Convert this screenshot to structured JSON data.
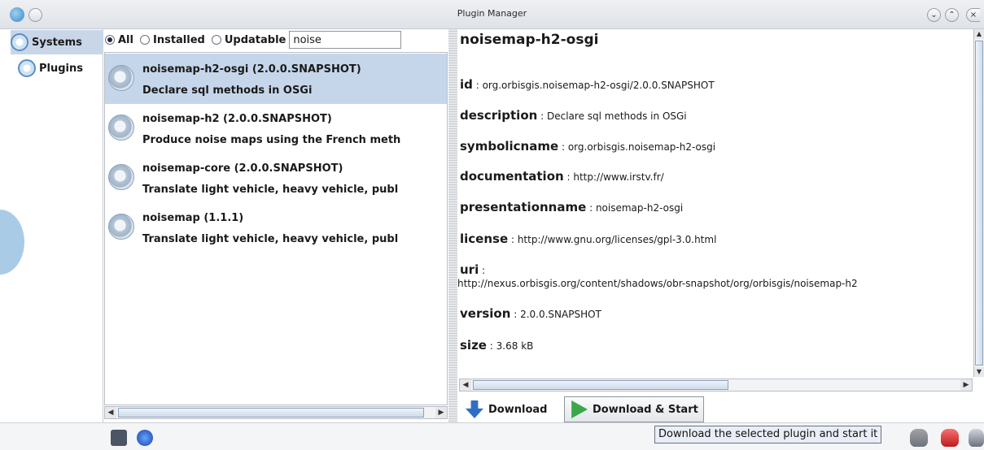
{
  "window": {
    "title": "Plugin Manager",
    "controls": [
      "minimize",
      "maximize",
      "close"
    ]
  },
  "nav": {
    "items": [
      {
        "label": "Systems",
        "selected": true
      },
      {
        "label": "Plugins",
        "selected": false
      }
    ]
  },
  "filter": {
    "options": [
      {
        "label": "All",
        "checked": true
      },
      {
        "label": "Installed",
        "checked": false
      },
      {
        "label": "Updatable",
        "checked": false
      }
    ],
    "search_value": "noise"
  },
  "plugins": [
    {
      "title": "noisemap-h2-osgi (2.0.0.SNAPSHOT)",
      "description": "Declare sql methods in OSGi",
      "selected": true
    },
    {
      "title": "noisemap-h2 (2.0.0.SNAPSHOT)",
      "description": "Produce noise maps using the French meth",
      "selected": false
    },
    {
      "title": "noisemap-core (2.0.0.SNAPSHOT)",
      "description": "Translate light vehicle, heavy vehicle, publ",
      "selected": false
    },
    {
      "title": "noisemap (1.1.1)",
      "description": "Translate light vehicle, heavy vehicle, publ",
      "selected": false
    }
  ],
  "details": {
    "title": "noisemap-h2-osgi",
    "properties": [
      {
        "key": "id",
        "sep": " : ",
        "value": "org.orbisgis.noisemap-h2-osgi/2.0.0.SNAPSHOT"
      },
      {
        "key": "description",
        "sep": " : ",
        "value": "Declare sql methods in OSGi"
      },
      {
        "key": "symbolicname",
        "sep": " : ",
        "value": "org.orbisgis.noisemap-h2-osgi"
      },
      {
        "key": "documentation",
        "sep": " : ",
        "value": "http://www.irstv.fr/"
      },
      {
        "key": "presentationname",
        "sep": " : ",
        "value": "noisemap-h2-osgi"
      },
      {
        "key": "license",
        "sep": " : ",
        "value": "http://www.gnu.org/licenses/gpl-3.0.html"
      },
      {
        "key": "uri",
        "sep": " :",
        "value": ""
      },
      {
        "key": "version",
        "sep": " : ",
        "value": "2.0.0.SNAPSHOT"
      },
      {
        "key": "size",
        "sep": " : ",
        "value": "3.68 kB"
      }
    ],
    "uri_value": "http://nexus.orbisgis.org/content/shadows/obr-snapshot/org/orbisgis/noisemap-h2"
  },
  "actions": {
    "download": "Download",
    "download_start": "Download & Start"
  },
  "tooltip": "Download the selected plugin and start it",
  "icons": {
    "app": "app-icon",
    "systems": "systems-gear-icon",
    "plugins": "plugins-gear-icon",
    "plugin_item": "plugin-gear-icon",
    "download": "arrow-down-icon",
    "download_start": "play-icon"
  },
  "colors": {
    "selection": "#c6d6ea",
    "nav_selection": "#c8d6e8",
    "accent_blue": "#2f6fc2",
    "accent_green": "#3aa84a"
  }
}
